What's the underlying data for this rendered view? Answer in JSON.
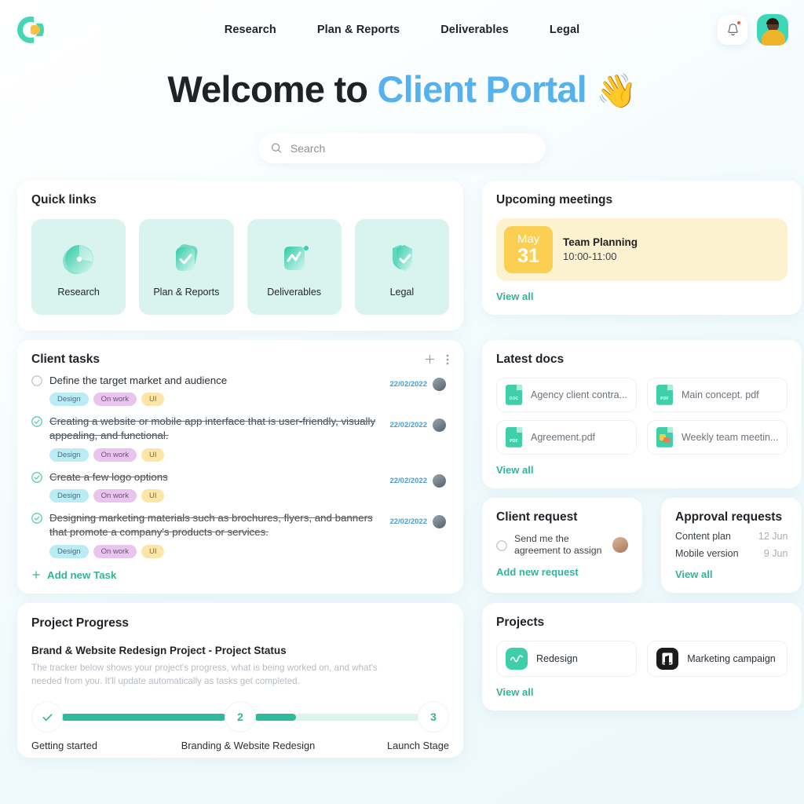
{
  "header": {
    "logo_name": "client-portal-logo",
    "nav": [
      {
        "label": "Research"
      },
      {
        "label": "Plan & Reports"
      },
      {
        "label": "Deliverables"
      },
      {
        "label": "Legal"
      }
    ],
    "notifications_icon": "bell-icon",
    "avatar_icon": "user-avatar"
  },
  "hero": {
    "title_prefix": "Welcome to",
    "title_accent": "Client Portal",
    "emoji": "👋",
    "accent_color": "#55b2ec"
  },
  "search": {
    "placeholder": "Search",
    "value": "",
    "icon": "search-icon"
  },
  "quick_links": {
    "title": "Quick links",
    "items": [
      {
        "label": "Research",
        "icon": "pie-chart-icon"
      },
      {
        "label": "Plan & Reports",
        "icon": "document-check-icon"
      },
      {
        "label": "Deliverables",
        "icon": "trend-chart-icon"
      },
      {
        "label": "Legal",
        "icon": "shield-check-icon"
      }
    ]
  },
  "meetings": {
    "title": "Upcoming meetings",
    "item": {
      "month": "May",
      "day": "31",
      "name": "Team Planning",
      "time": "10:00-11:00"
    },
    "view_all": "View all",
    "badge_color": "#fbcf51"
  },
  "tasks": {
    "title": "Client tasks",
    "add_icon": "plus-icon",
    "menu_icon": "more-vertical-icon",
    "items": [
      {
        "text": "Define the target market and audience",
        "done": false,
        "date": "22/02/2022",
        "tags": [
          "Design",
          "On work",
          "UI"
        ]
      },
      {
        "text": "Creating a website or mobile app interface that is user-friendly, visually appealing, and functional.",
        "done": true,
        "date": "22/02/2022",
        "tags": [
          "Design",
          "On work",
          "UI"
        ]
      },
      {
        "text": "Create a few logo options",
        "done": true,
        "date": "22/02/2022",
        "tags": [
          "Design",
          "On work",
          "UI"
        ]
      },
      {
        "text": "Designing marketing materials such as brochures, flyers, and banners that promote a company's products or services.",
        "done": true,
        "date": "22/02/2022",
        "tags": [
          "Design",
          "On work",
          "UI"
        ]
      }
    ],
    "add_new_label": "Add new Task"
  },
  "docs": {
    "title": "Latest docs",
    "items": [
      {
        "name": "Agency client contra...",
        "type": "DOC"
      },
      {
        "name": "Main concept. pdf",
        "type": "PDF"
      },
      {
        "name": "Agreement.pdf",
        "type": "PDF"
      },
      {
        "name": "Weekly team meetin...",
        "type": "SLIDES"
      }
    ],
    "view_all": "View all"
  },
  "client_request": {
    "title": "Client request",
    "item_text": "Send me the agreement to assign",
    "add_new_label": "Add new request"
  },
  "approvals": {
    "title": "Approval requests",
    "items": [
      {
        "name": "Content plan",
        "date": "12 Jun"
      },
      {
        "name": "Mobile version",
        "date": "9 Jun"
      }
    ],
    "view_all": "View all"
  },
  "progress": {
    "title": "Project Progress",
    "subtitle": "Brand & Website Redesign Project - Project Status",
    "description": "The tracker below shows your project's progress, what is being worked on, and what's needed from you. It'll update automatically as tasks get completed.",
    "steps": [
      {
        "label": "Getting started",
        "marker": "✓",
        "state": "complete"
      },
      {
        "label": "Branding & Website Redesign",
        "marker": "2",
        "state": "current"
      },
      {
        "label": "Launch Stage",
        "marker": "3",
        "state": "pending"
      }
    ],
    "segment_fill_percent": [
      100,
      25
    ],
    "accent_color": "#2fba9b"
  },
  "projects": {
    "title": "Projects",
    "items": [
      {
        "name": "Redesign",
        "icon": "wave-icon"
      },
      {
        "name": "Marketing campaign",
        "icon": "building-icon"
      }
    ],
    "view_all": "View all"
  }
}
